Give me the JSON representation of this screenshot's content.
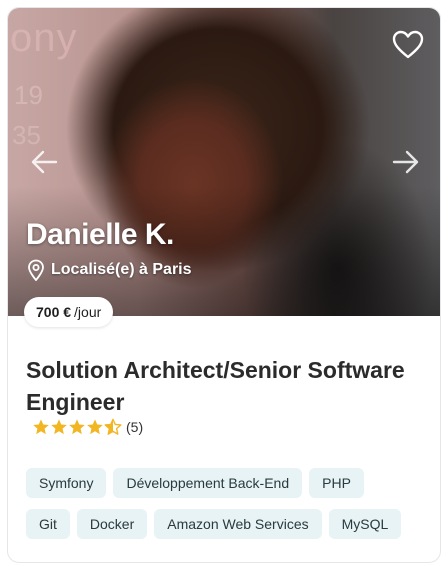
{
  "profile": {
    "name": "Danielle K.",
    "location": "Localisé(e) à Paris",
    "rate_value": "700 €",
    "rate_unit": "/jour",
    "title": "Solution Architect/Senior Software Engineer",
    "rating": 4.5,
    "review_count": "(5)"
  },
  "photo_background_text": {
    "line1": "ony",
    "line2": "19",
    "line3": "35"
  },
  "tags": {
    "row1": [
      "Symfony",
      "Développement Back-End",
      "PHP"
    ],
    "row2": [
      "Git",
      "Docker",
      "Amazon Web Services",
      "MySQL"
    ]
  },
  "icons": {
    "favorite": "heart-icon",
    "prev": "arrow-left-icon",
    "next": "arrow-right-icon",
    "location": "map-pin-icon",
    "star": "star-icon"
  },
  "colors": {
    "star": "#f2b623",
    "tag_bg": "#e7f3f5"
  }
}
